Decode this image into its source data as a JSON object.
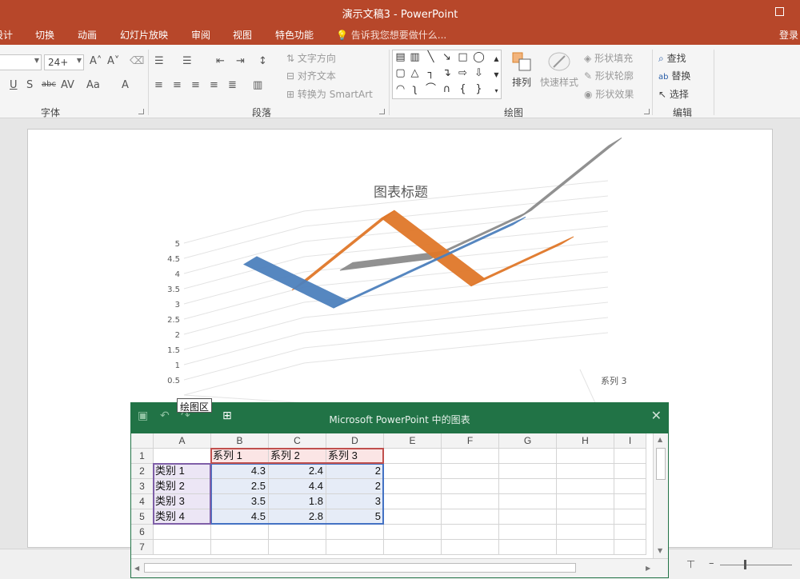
{
  "window": {
    "title": "演示文稿3 - PowerPoint"
  },
  "tabs": [
    {
      "label": "设计"
    },
    {
      "label": "切换"
    },
    {
      "label": "动画"
    },
    {
      "label": "幻灯片放映"
    },
    {
      "label": "审阅"
    },
    {
      "label": "视图"
    },
    {
      "label": "特色功能"
    }
  ],
  "tell_me": "告诉我您想要做什么...",
  "login": "登录",
  "ribbon": {
    "font_size": "24+",
    "groups": {
      "font": "字体",
      "paragraph": "段落",
      "drawing": "绘图",
      "editing": "编辑"
    },
    "paragraph": {
      "text_direction": "文字方向",
      "align_text": "对齐文本",
      "smartart": "转换为 SmartArt"
    },
    "drawing": {
      "arrange": "排列",
      "quick_styles": "快速样式",
      "shape_fill": "形状填充",
      "shape_outline": "形状轮廓",
      "shape_effects": "形状效果"
    },
    "editing": {
      "find": "查找",
      "replace": "替换",
      "select": "选择"
    }
  },
  "tooltip": "绘图区",
  "chart_data": {
    "type": "line",
    "title": "图表标题",
    "categories": [
      "类别 1",
      "类别 2",
      "类别 3",
      "类别 4"
    ],
    "series": [
      {
        "name": "系列 1",
        "values": [
          4.3,
          2.5,
          3.5,
          4.5
        ],
        "color": "#4e81bd"
      },
      {
        "name": "系列 2",
        "values": [
          2.4,
          4.4,
          1.8,
          2.8
        ],
        "color": "#e0782a"
      },
      {
        "name": "系列 3",
        "values": [
          2,
          2,
          3,
          5
        ],
        "color": "#8c8c8c"
      }
    ],
    "yticks": [
      "0.5",
      "1",
      "1.5",
      "2",
      "2.5",
      "3",
      "3.5",
      "4",
      "4.5",
      "5"
    ],
    "ylim": [
      0,
      5
    ],
    "grid": true,
    "visible_series_label": "系列 3"
  },
  "excel": {
    "title": "Microsoft PowerPoint 中的图表",
    "columns": [
      "A",
      "B",
      "C",
      "D",
      "E",
      "F",
      "G",
      "H",
      "I"
    ],
    "rows": [
      "1",
      "2",
      "3",
      "4",
      "5",
      "6",
      "7"
    ],
    "cells": [
      [
        "",
        "系列 1",
        "系列 2",
        "系列 3"
      ],
      [
        "类别 1",
        "4.3",
        "2.4",
        "2"
      ],
      [
        "类别 2",
        "2.5",
        "4.4",
        "2"
      ],
      [
        "类别 3",
        "3.5",
        "1.8",
        "3"
      ],
      [
        "类别 4",
        "4.5",
        "2.8",
        "5"
      ]
    ]
  },
  "colors": {
    "accent": "#b7472a",
    "excel": "#217346"
  }
}
